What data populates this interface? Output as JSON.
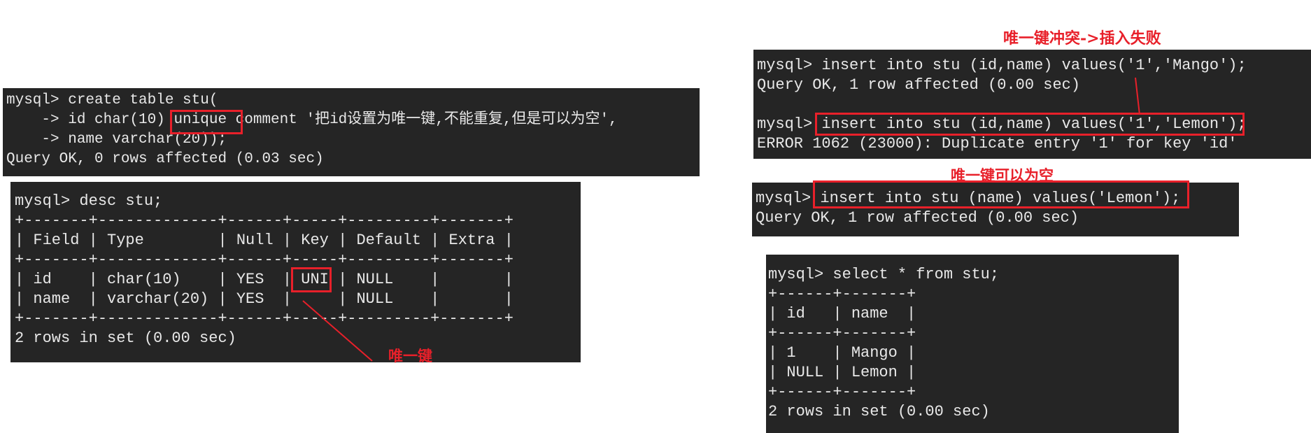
{
  "create_panel": {
    "lines": [
      "mysql> create table stu(",
      "    -> id char(10) unique comment '把id设置为唯一键,不能重复,但是可以为空',",
      "    -> name varchar(20));",
      "Query OK, 0 rows affected (0.03 sec)"
    ]
  },
  "desc_panel": {
    "lines": [
      "mysql> desc stu;",
      "+-------+-------------+------+-----+---------+-------+",
      "| Field | Type        | Null | Key | Default | Extra |",
      "+-------+-------------+------+-----+---------+-------+",
      "| id    | char(10)    | YES  | UNI | NULL    |       |",
      "| name  | varchar(20) | YES  |     | NULL    |       |",
      "+-------+-------------+------+-----+---------+-------+",
      "2 rows in set (0.00 sec)"
    ],
    "annotation": "唯一键"
  },
  "insert_conflict_panel": {
    "annotation": "唯一键冲突->插入失败",
    "lines": [
      "mysql> insert into stu (id,name) values('1','Mango');",
      "Query OK, 1 row affected (0.00 sec)",
      "",
      "mysql> insert into stu (id,name) values('1','Lemon');",
      "ERROR 1062 (23000): Duplicate entry '1' for key 'id'"
    ]
  },
  "insert_null_panel": {
    "annotation": "唯一键可以为空",
    "lines": [
      "mysql> insert into stu (name) values('Lemon');",
      "Query OK, 1 row affected (0.00 sec)"
    ]
  },
  "select_panel": {
    "lines": [
      "mysql> select * from stu;",
      "+------+-------+",
      "| id   | name  |",
      "+------+-------+",
      "| 1    | Mango |",
      "| NULL | Lemon |",
      "+------+-------+",
      "2 rows in set (0.00 sec)"
    ]
  },
  "colors": {
    "terminal_bg": "#252525",
    "annotation": "#e8202a"
  }
}
